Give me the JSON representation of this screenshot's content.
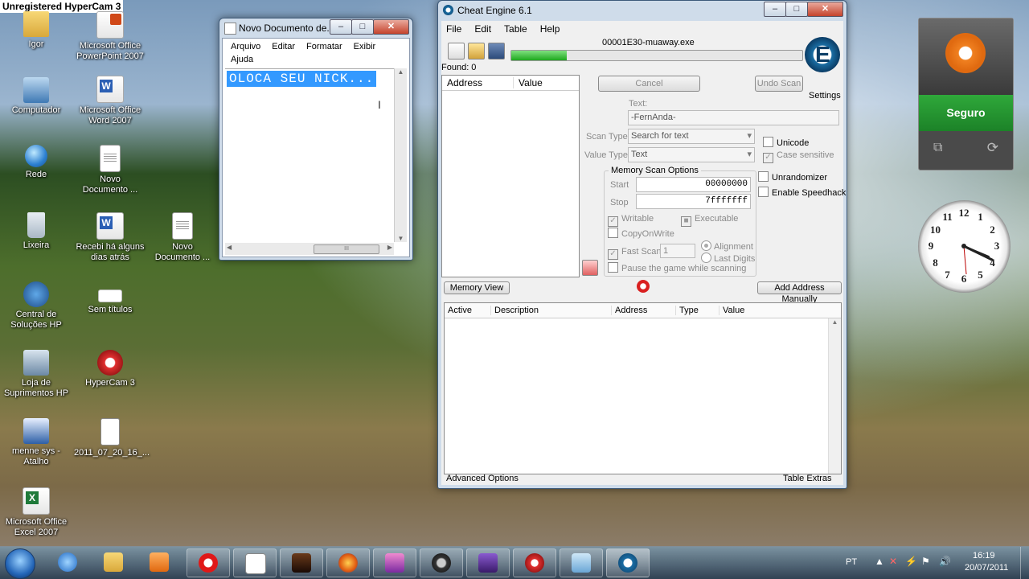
{
  "hypercam_banner": "Unregistered HyperCam 3",
  "desktop_icons": [
    {
      "label": "Igor"
    },
    {
      "label": "Microsoft Office PowerPoint 2007"
    },
    {
      "label": "Computador"
    },
    {
      "label": "Microsoft Office Word 2007"
    },
    {
      "label": "Rede"
    },
    {
      "label": "Novo Documento ..."
    },
    {
      "label": "Lixeira"
    },
    {
      "label": "Recebi há alguns dias atrás"
    },
    {
      "label": "Novo Documento ..."
    },
    {
      "label": "Central de Soluções HP"
    },
    {
      "label": "Sem títulos"
    },
    {
      "label": "Loja de Suprimentos HP"
    },
    {
      "label": "HyperCam 3"
    },
    {
      "label": "menne sys - Atalho"
    },
    {
      "label": "2011_07_20_16_..."
    },
    {
      "label": "Microsoft Office Excel 2007"
    }
  ],
  "notepad": {
    "title": "Novo Documento de...",
    "menu": [
      "Arquivo",
      "Editar",
      "Formatar",
      "Exibir",
      "Ajuda"
    ],
    "text": "OLOCA SEU NICK...",
    "scroll_thumb": "III"
  },
  "cheat_engine": {
    "title": "Cheat Engine 6.1",
    "menu": [
      "File",
      "Edit",
      "Table",
      "Help"
    ],
    "process": "00001E30-muaway.exe",
    "progress": 0.19,
    "found": "Found: 0",
    "list_columns": [
      "Address",
      "Value"
    ],
    "cancel": "Cancel",
    "undo_scan": "Undo Scan",
    "settings": "Settings",
    "text_label": "Text:",
    "text_value": "-FernAnda-",
    "scan_type_label": "Scan Type",
    "scan_type_value": "Search for text",
    "value_type_label": "Value Type",
    "value_type_value": "Text",
    "unicode": "Unicode",
    "case_sensitive": "Case sensitive",
    "memory_scan_options": "Memory Scan Options",
    "start_label": "Start",
    "start_value": "00000000",
    "stop_label": "Stop",
    "stop_value": "7fffffff",
    "writable": "Writable",
    "executable": "Executable",
    "copy_on_write": "CopyOnWrite",
    "fast_scan": "Fast Scan",
    "fast_scan_value": "1",
    "alignment": "Alignment",
    "last_digits": "Last Digits",
    "pause_game": "Pause the game while scanning",
    "unrandomizer": "Unrandomizer",
    "enable_speedhack": "Enable Speedhack",
    "memory_view": "Memory View",
    "add_address_manually": "Add Address Manually",
    "table_columns": [
      "Active",
      "Description",
      "Address",
      "Type",
      "Value"
    ],
    "advanced_options": "Advanced Options",
    "table_extras": "Table Extras"
  },
  "avast": {
    "status": "Seguro"
  },
  "clock_numbers": [
    "12",
    "1",
    "2",
    "3",
    "4",
    "5",
    "6",
    "7",
    "8",
    "9",
    "10",
    "11"
  ],
  "tray": {
    "language": "PT",
    "time": "16:19",
    "date": "20/07/2011"
  }
}
